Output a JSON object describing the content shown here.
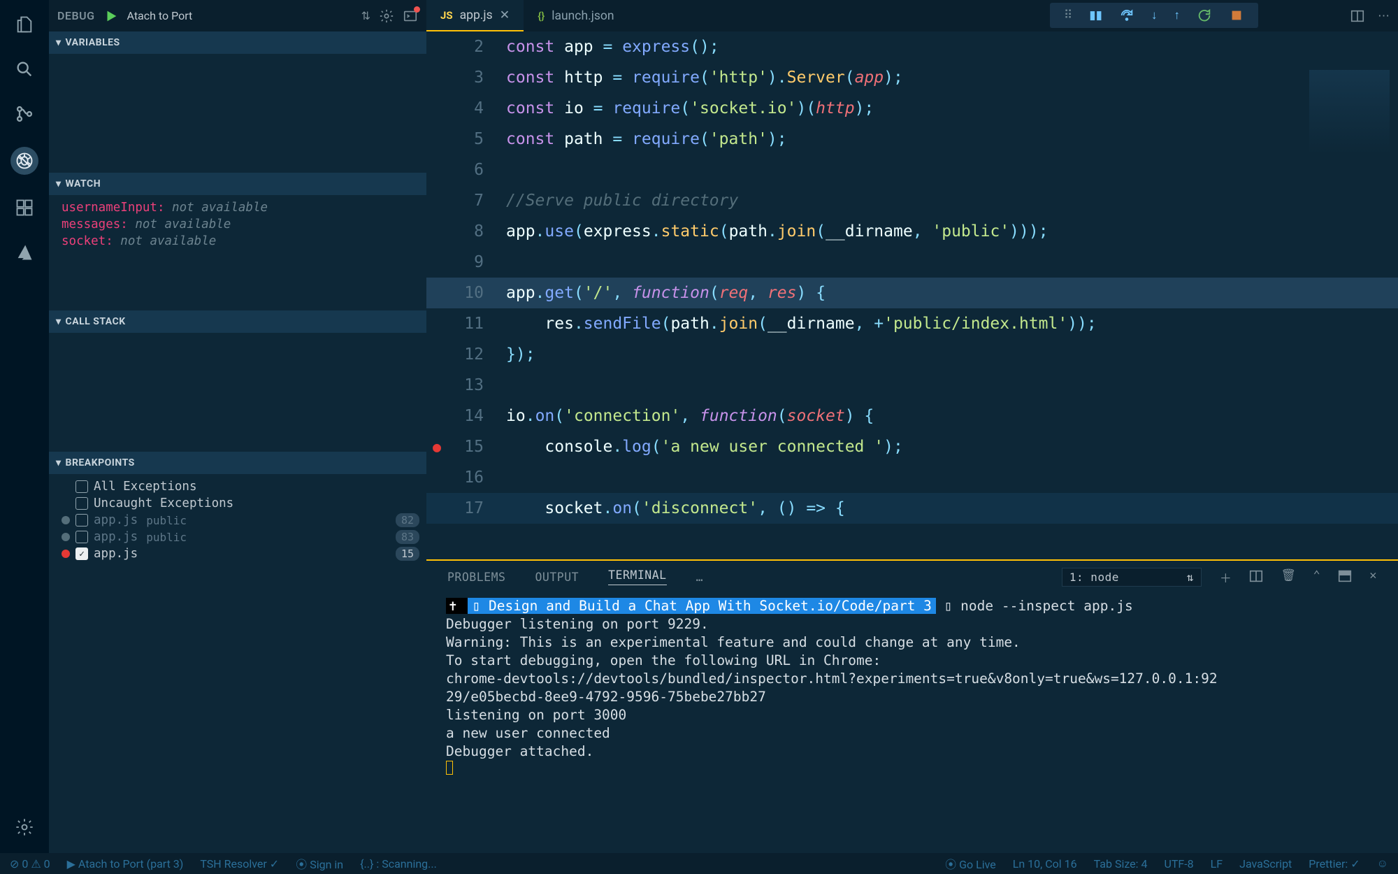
{
  "activity": {
    "icons": [
      "files",
      "search",
      "scm",
      "debug",
      "extensions",
      "azure"
    ],
    "active": "debug"
  },
  "debug": {
    "title": "DEBUG",
    "config": "Atach to Port",
    "toolbar_buttons": [
      "variables",
      "watch",
      "call_stack",
      "breakpoints"
    ]
  },
  "sections": {
    "variables": "VARIABLES",
    "watch": "WATCH",
    "callstack": "CALL STACK",
    "breakpoints": "BREAKPOINTS"
  },
  "watch": [
    {
      "name": "usernameInput",
      "state": "not available"
    },
    {
      "name": "messages",
      "state": "not available"
    },
    {
      "name": "socket",
      "state": "not available"
    }
  ],
  "breakpoints": {
    "items": [
      {
        "kind": "all",
        "label": "All Exceptions",
        "checked": false
      },
      {
        "kind": "uncaught",
        "label": "Uncaught Exceptions",
        "checked": false
      },
      {
        "kind": "bp",
        "file": "app.js",
        "sub": "public",
        "line": "82",
        "active": false
      },
      {
        "kind": "bp",
        "file": "app.js",
        "sub": "public",
        "line": "83",
        "active": false
      },
      {
        "kind": "bp",
        "file": "app.js",
        "sub": "",
        "line": "15",
        "active": true
      }
    ]
  },
  "tabs": [
    {
      "lang": "JS",
      "label": "app.js",
      "active": true,
      "closable": true
    },
    {
      "lang": "{}",
      "label": "launch.json",
      "active": false,
      "closable": false
    }
  ],
  "debug_toolbar": [
    "drag",
    "pause",
    "step-over",
    "step-into",
    "step-out",
    "restart",
    "stop"
  ],
  "editor": {
    "lines": [
      {
        "n": 2,
        "segs": [
          [
            "kw",
            "const "
          ],
          [
            "id",
            "app"
          ],
          [
            "op",
            " = "
          ],
          [
            "fn",
            "express"
          ],
          [
            "op",
            "();"
          ]
        ]
      },
      {
        "n": 3,
        "segs": [
          [
            "kw",
            "const "
          ],
          [
            "id",
            "http"
          ],
          [
            "op",
            " = "
          ],
          [
            "fn",
            "require"
          ],
          [
            "op",
            "("
          ],
          [
            "str",
            "'http'"
          ],
          [
            "op",
            ")."
          ],
          [
            "fn2",
            "Server"
          ],
          [
            "op",
            "("
          ],
          [
            "var",
            "app"
          ],
          [
            "op",
            ");"
          ]
        ]
      },
      {
        "n": 4,
        "segs": [
          [
            "kw",
            "const "
          ],
          [
            "id",
            "io"
          ],
          [
            "op",
            " = "
          ],
          [
            "fn",
            "require"
          ],
          [
            "op",
            "("
          ],
          [
            "str",
            "'socket.io'"
          ],
          [
            "op",
            ")("
          ],
          [
            "var",
            "http"
          ],
          [
            "op",
            ");"
          ]
        ]
      },
      {
        "n": 5,
        "segs": [
          [
            "kw",
            "const "
          ],
          [
            "id",
            "path"
          ],
          [
            "op",
            " = "
          ],
          [
            "fn",
            "require"
          ],
          [
            "op",
            "("
          ],
          [
            "str",
            "'path'"
          ],
          [
            "op",
            ");"
          ]
        ]
      },
      {
        "n": 6,
        "segs": []
      },
      {
        "n": 7,
        "segs": [
          [
            "cmt",
            "//Serve public directory"
          ]
        ]
      },
      {
        "n": 8,
        "segs": [
          [
            "id",
            "app"
          ],
          [
            "op",
            "."
          ],
          [
            "prop",
            "use"
          ],
          [
            "op",
            "("
          ],
          [
            "id",
            "express"
          ],
          [
            "op",
            "."
          ],
          [
            "fn2",
            "static"
          ],
          [
            "op",
            "("
          ],
          [
            "id",
            "path"
          ],
          [
            "op",
            "."
          ],
          [
            "fn2",
            "join"
          ],
          [
            "op",
            "("
          ],
          [
            "id",
            "__dirname"
          ],
          [
            "op",
            ", "
          ],
          [
            "str",
            "'public'"
          ],
          [
            "op",
            ")));"
          ]
        ]
      },
      {
        "n": 9,
        "segs": []
      },
      {
        "n": 10,
        "hl": "hl-line",
        "segs": [
          [
            "id",
            "app"
          ],
          [
            "op",
            "."
          ],
          [
            "prop",
            "get"
          ],
          [
            "op",
            "("
          ],
          [
            "str",
            "'/'"
          ],
          [
            "op",
            ", "
          ],
          [
            "kw2",
            "function"
          ],
          [
            "op",
            "("
          ],
          [
            "var",
            "req"
          ],
          [
            "op",
            ", "
          ],
          [
            "var",
            "res"
          ],
          [
            "op",
            ") {"
          ]
        ]
      },
      {
        "n": 11,
        "segs": [
          [
            "",
            "    "
          ],
          [
            "id",
            "res"
          ],
          [
            "op",
            "."
          ],
          [
            "prop",
            "sendFile"
          ],
          [
            "op",
            "("
          ],
          [
            "id",
            "path"
          ],
          [
            "op",
            "."
          ],
          [
            "fn2",
            "join"
          ],
          [
            "op",
            "("
          ],
          [
            "id",
            "__dirname"
          ],
          [
            "op",
            ", +"
          ],
          [
            "str",
            "'public/index.html'"
          ],
          [
            "op",
            "));"
          ]
        ]
      },
      {
        "n": 12,
        "segs": [
          [
            "op",
            "});"
          ]
        ]
      },
      {
        "n": 13,
        "segs": []
      },
      {
        "n": 14,
        "segs": [
          [
            "id",
            "io"
          ],
          [
            "op",
            "."
          ],
          [
            "prop",
            "on"
          ],
          [
            "op",
            "("
          ],
          [
            "str",
            "'connection'"
          ],
          [
            "op",
            ", "
          ],
          [
            "kw2",
            "function"
          ],
          [
            "op",
            "("
          ],
          [
            "var",
            "socket"
          ],
          [
            "op",
            ") {"
          ]
        ]
      },
      {
        "n": 15,
        "bp": true,
        "segs": [
          [
            "",
            "    "
          ],
          [
            "id",
            "console"
          ],
          [
            "op",
            "."
          ],
          [
            "prop",
            "log"
          ],
          [
            "op",
            "("
          ],
          [
            "str",
            "'a new user connected '"
          ],
          [
            "op",
            ");"
          ]
        ]
      },
      {
        "n": 16,
        "segs": []
      },
      {
        "n": 17,
        "hl": "secondary-hl",
        "segs": [
          [
            "",
            "    "
          ],
          [
            "id",
            "socket"
          ],
          [
            "op",
            "."
          ],
          [
            "prop",
            "on"
          ],
          [
            "op",
            "("
          ],
          [
            "str",
            "'disconnect'"
          ],
          [
            "op",
            ", ("
          ],
          [
            "op",
            ") "
          ],
          [
            "op",
            "=> {"
          ]
        ]
      }
    ]
  },
  "panel": {
    "tabs": [
      "PROBLEMS",
      "OUTPUT",
      "TERMINAL",
      "…"
    ],
    "active": "TERMINAL",
    "term_select": "1: node",
    "lines": [
      {
        "pre": "✝ ",
        "path": "▯ Design and Build a Chat App With Socket.io/Code/part 3",
        "tail": " ▯ node --inspect app.js"
      },
      "Debugger listening on port 9229.",
      "Warning: This is an experimental feature and could change at any time.",
      "To start debugging, open the following URL in Chrome:",
      "    chrome-devtools://devtools/bundled/inspector.html?experiments=true&v8only=true&ws=127.0.0.1:92",
      "29/e05becbd-8ee9-4792-9596-75bebe27bb27",
      "listening on port 3000",
      "a new user connected",
      "Debugger attached."
    ]
  },
  "statusbar": {
    "left": [
      {
        "t": "⊘ 0 ⚠ 0"
      },
      {
        "t": "▶ Atach to Port (part 3)"
      },
      {
        "t": "TSH Resolver ✓"
      },
      {
        "t": "⦿ Sign in"
      },
      {
        "t": "{..} : Scanning..."
      }
    ],
    "right": [
      {
        "t": "⦿ Go Live"
      },
      {
        "t": "Ln 10, Col 16"
      },
      {
        "t": "Tab Size: 4"
      },
      {
        "t": "UTF-8"
      },
      {
        "t": "LF"
      },
      {
        "t": "JavaScript"
      },
      {
        "t": "Prettier: ✓"
      },
      {
        "t": "☺"
      }
    ]
  }
}
